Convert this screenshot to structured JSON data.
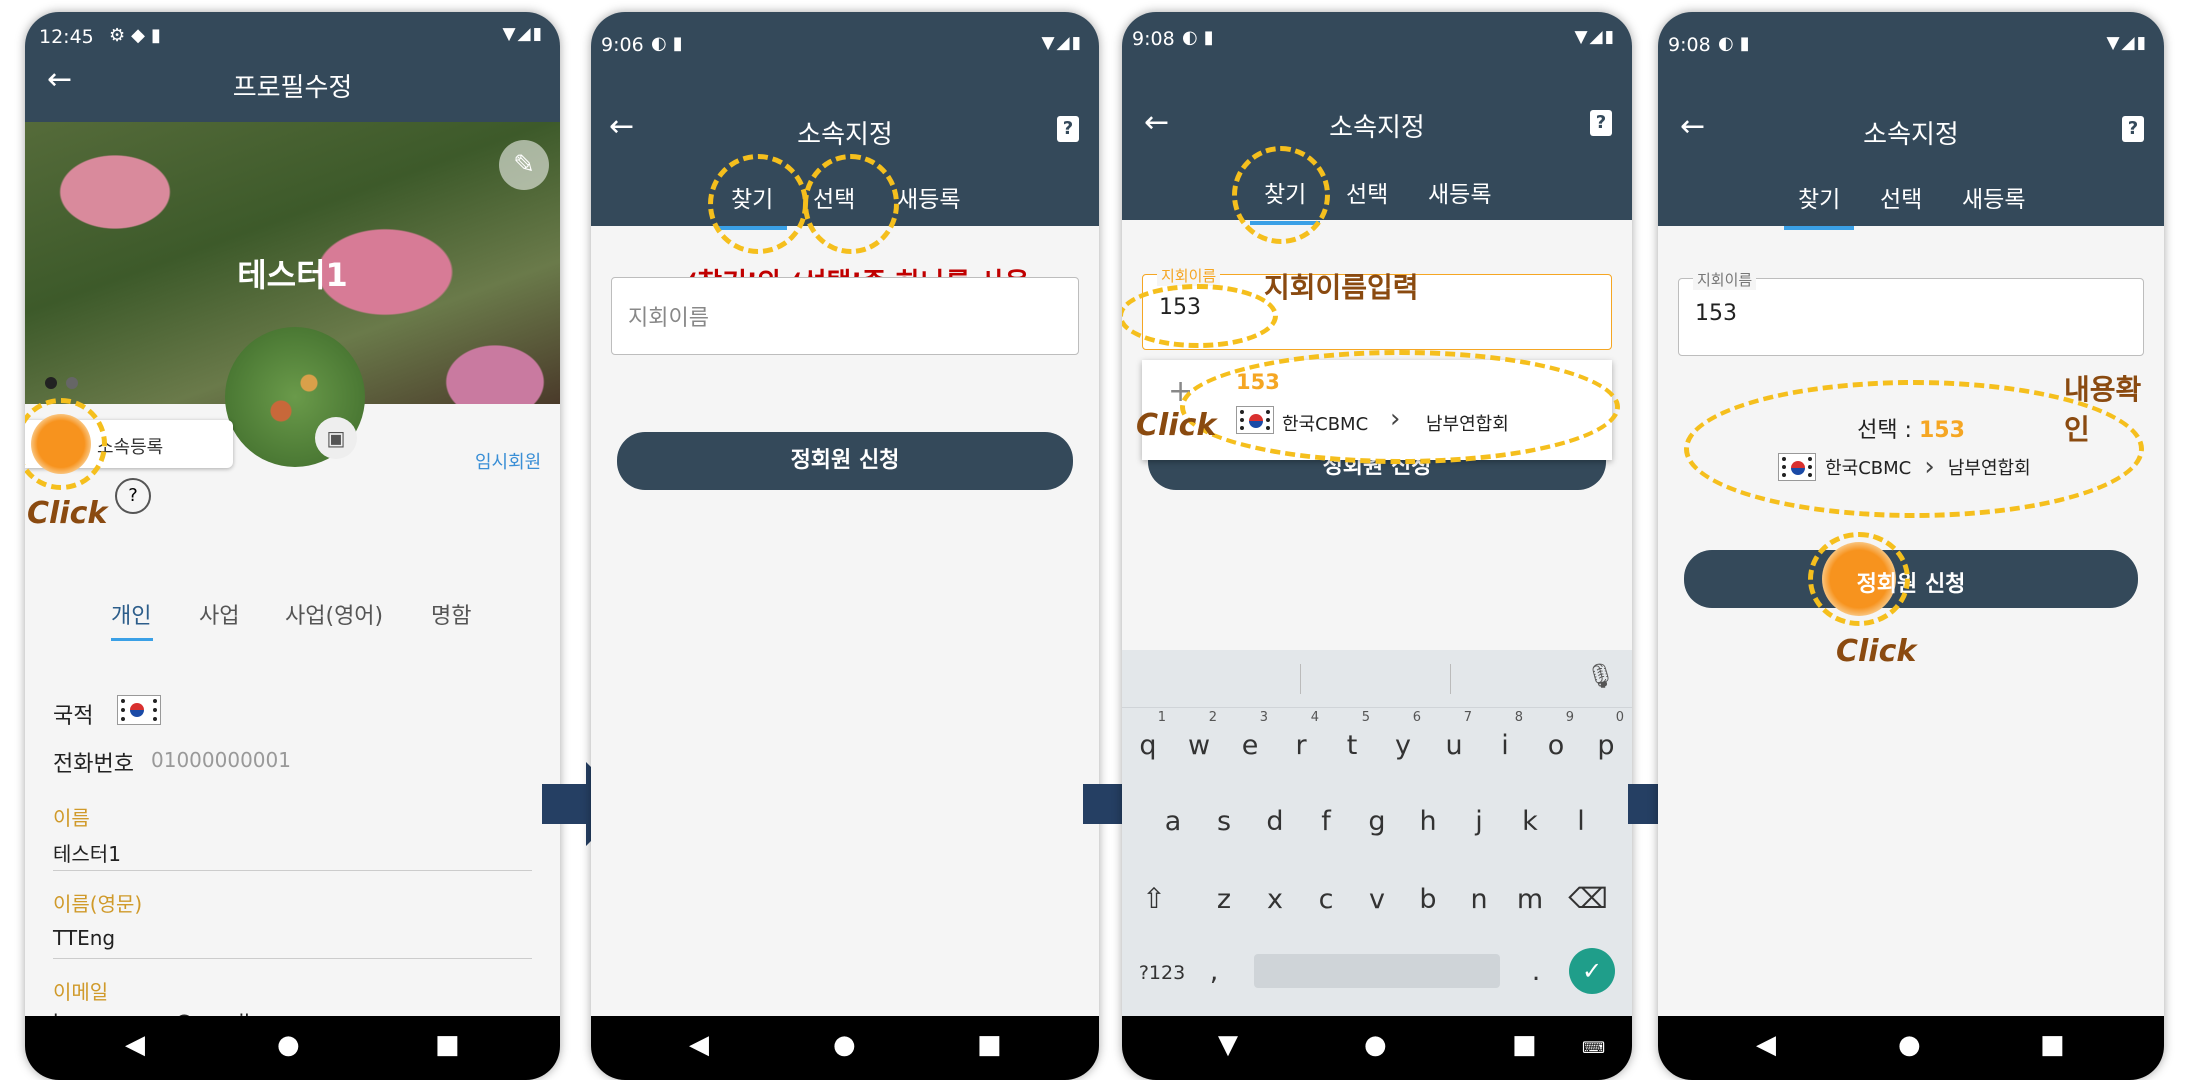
{
  "colors": {
    "header": "#34495a",
    "accent_tab": "#3aa0e6",
    "highlight": "#f5bf1d",
    "orange": "#f7931e",
    "annotation_red": "#c00000",
    "annotation_brown": "#8a4a10",
    "arrow": "#253f63"
  },
  "screen1": {
    "status_time": "12:45",
    "title": "프로필수정",
    "profile_name": "테스터1",
    "affiliation_button": "소속등록",
    "member_status": "임시회원",
    "help_mark": "?",
    "tabs": [
      "개인",
      "사업",
      "사업(영어)",
      "명함"
    ],
    "nationality_label": "국적",
    "phone_label": "전화번호",
    "phone_value": "01000000001",
    "name_label": "이름",
    "name_value": "테스터1",
    "name_en_label": "이름(영문)",
    "name_en_value": "TTEng",
    "email_label": "이메일",
    "email_value": "koenewman@gmail.com",
    "click_label": "Click"
  },
  "screen2": {
    "status_time": "9:06",
    "title": "소속지정",
    "tabs": [
      "찾기",
      "선택",
      "새등록"
    ],
    "annotation": "‘찾기’와 ‘선택’중 하나를 사용",
    "field_placeholder": "지회이름",
    "submit_button": "정회원 신청"
  },
  "screen3": {
    "status_time": "9:08",
    "title": "소속지정",
    "tabs": [
      "찾기",
      "선택",
      "새등록"
    ],
    "field_label": "지회이름",
    "field_value": "153",
    "annotation": "지회이름입력",
    "suggestion_number": "153",
    "suggestion_country": "한국CBMC",
    "suggestion_region": "남부연합회",
    "submit_button": "정회원 신청",
    "click_label": "Click",
    "keyboard_rows": [
      [
        "q",
        "w",
        "e",
        "r",
        "t",
        "y",
        "u",
        "i",
        "o",
        "p"
      ],
      [
        "a",
        "s",
        "d",
        "f",
        "g",
        "h",
        "j",
        "k",
        "l"
      ],
      [
        "z",
        "x",
        "c",
        "v",
        "b",
        "n",
        "m"
      ]
    ],
    "number_hints": [
      "1",
      "2",
      "3",
      "4",
      "5",
      "6",
      "7",
      "8",
      "9",
      "0"
    ],
    "symbol_key": "?123",
    "comma_key": ",",
    "period_key": "."
  },
  "screen4": {
    "status_time": "9:08",
    "title": "소속지정",
    "tabs": [
      "찾기",
      "선택",
      "새등록"
    ],
    "field_label": "지회이름",
    "field_value": "153",
    "selection_prefix": "선택 : ",
    "selection_number": "153",
    "selection_country": "한국CBMC",
    "selection_region": "남부연합회",
    "annotation": "내용확인",
    "submit_button": "정회원 신청",
    "click_label": "Click"
  }
}
